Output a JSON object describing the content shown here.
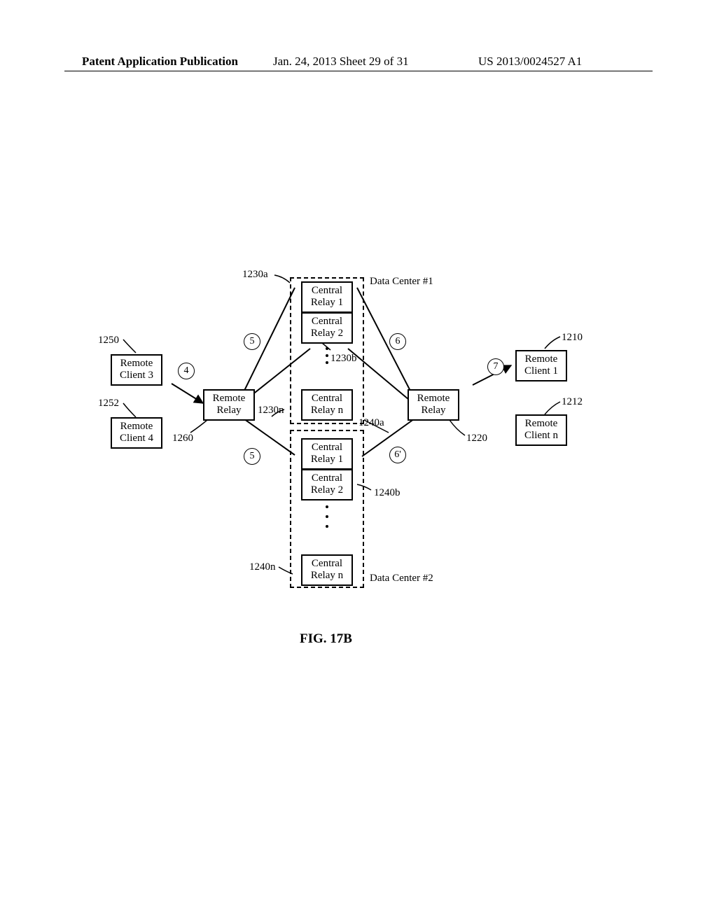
{
  "header": {
    "left": "Patent Application Publication",
    "mid": "Jan. 24, 2013  Sheet 29 of 31",
    "right": "US 2013/0024527 A1"
  },
  "figure_title": "FIG. 17B",
  "dc1_label": "Data Center #1",
  "dc2_label": "Data Center #2",
  "boxes": {
    "central_relay_1a": "Central\nRelay 1",
    "central_relay_2a": "Central\nRelay 2",
    "central_relay_na": "Central\nRelay n",
    "central_relay_1b": "Central\nRelay 1",
    "central_relay_2b": "Central\nRelay 2",
    "central_relay_nb": "Central\nRelay n",
    "remote_relay_left": "Remote\nRelay",
    "remote_relay_right": "Remote\nRelay",
    "remote_client_3": "Remote\nClient 3",
    "remote_client_4": "Remote\nClient 4",
    "remote_client_1": "Remote\nClient 1",
    "remote_client_n": "Remote\nClient n"
  },
  "refs": {
    "r1230a": "1230a",
    "r1230b": "1230b",
    "r1230n": "1230n",
    "r1240a": "1240a",
    "r1240b": "1240b",
    "r1240n": "1240n",
    "r1250": "1250",
    "r1252": "1252",
    "r1260": "1260",
    "r1210": "1210",
    "r1212": "1212",
    "r1220": "1220"
  },
  "circles": {
    "c4": "4",
    "c5a": "5",
    "c5b": "5",
    "c6a": "6",
    "c6b": "6'",
    "c7": "7"
  }
}
